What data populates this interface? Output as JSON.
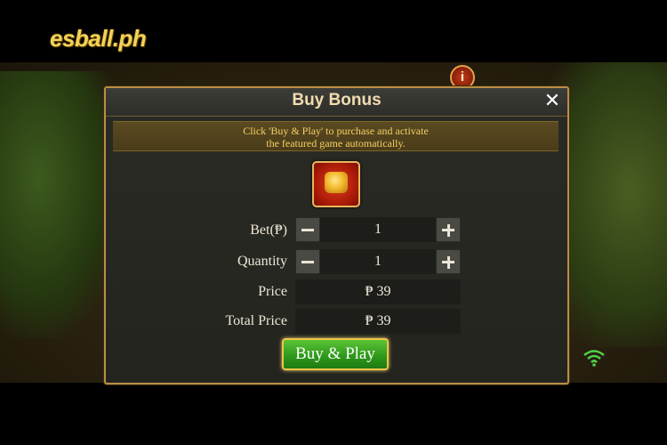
{
  "brand": {
    "logo_text": "esball.ph"
  },
  "dialog": {
    "title": "Buy Bonus",
    "close_symbol": "✕",
    "notice_line1": "Click 'Buy & Play' to purchase and activate",
    "notice_line2": "the featured game automatically.",
    "bonus_icon": "gold-pot-icon",
    "rows": {
      "bet": {
        "label": "Bet(₱)",
        "value": "1"
      },
      "quantity": {
        "label": "Quantity",
        "value": "1"
      },
      "price": {
        "label": "Price",
        "value": "₱ 39"
      },
      "total_price": {
        "label": "Total Price",
        "value": "₱ 39"
      }
    },
    "play_button": "Buy & Play"
  },
  "colors": {
    "accent_gold": "#b98e45",
    "notice_text": "#f5cf63",
    "play_button": "#2e9a1c"
  }
}
